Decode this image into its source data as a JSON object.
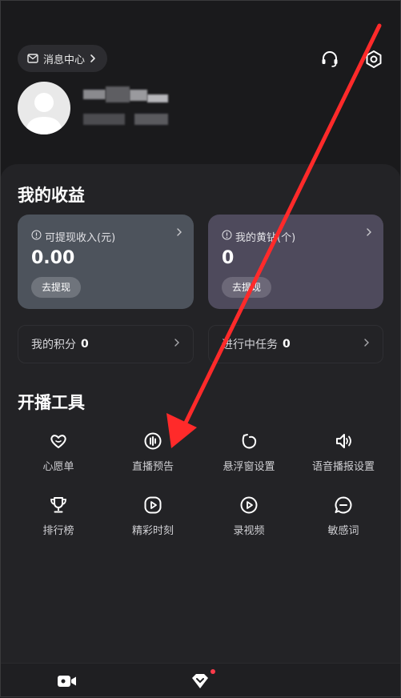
{
  "header": {
    "message_center_label": "消息中心",
    "icons": [
      "mail-icon",
      "chevron-right-icon",
      "headset-icon",
      "settings-icon"
    ]
  },
  "profile": {
    "avatar": "avatar-placeholder"
  },
  "earnings": {
    "title": "我的收益",
    "left_card": {
      "label": "可提现收入(元)",
      "value": "0.00",
      "button": "去提现"
    },
    "right_card": {
      "label": "我的黄钻(个)",
      "value": "0",
      "button": "去提现"
    },
    "points": {
      "label": "我的积分",
      "value": "0"
    },
    "tasks": {
      "label": "进行中任务",
      "value": "0"
    }
  },
  "tools": {
    "title": "开播工具",
    "items": [
      {
        "label": "心愿单",
        "icon": "heart-icon"
      },
      {
        "label": "直播预告",
        "icon": "live-preview-icon"
      },
      {
        "label": "悬浮窗设置",
        "icon": "floating-window-icon"
      },
      {
        "label": "语音播报设置",
        "icon": "speaker-icon"
      },
      {
        "label": "排行榜",
        "icon": "trophy-icon"
      },
      {
        "label": "精彩时刻",
        "icon": "highlight-play-icon"
      },
      {
        "label": "录视频",
        "icon": "record-video-icon"
      },
      {
        "label": "敏感词",
        "icon": "chat-bubble-icon"
      }
    ]
  },
  "bottom_nav": {
    "items": [
      "video-camera-icon",
      "diamond-icon"
    ],
    "badge_color": "#ff3b4a"
  },
  "colors": {
    "background": "#1a1a1c",
    "panel": "#232326",
    "card_left": "#4d535c",
    "card_right": "#4e4a5c",
    "annotation_arrow": "#ff2a2a"
  }
}
